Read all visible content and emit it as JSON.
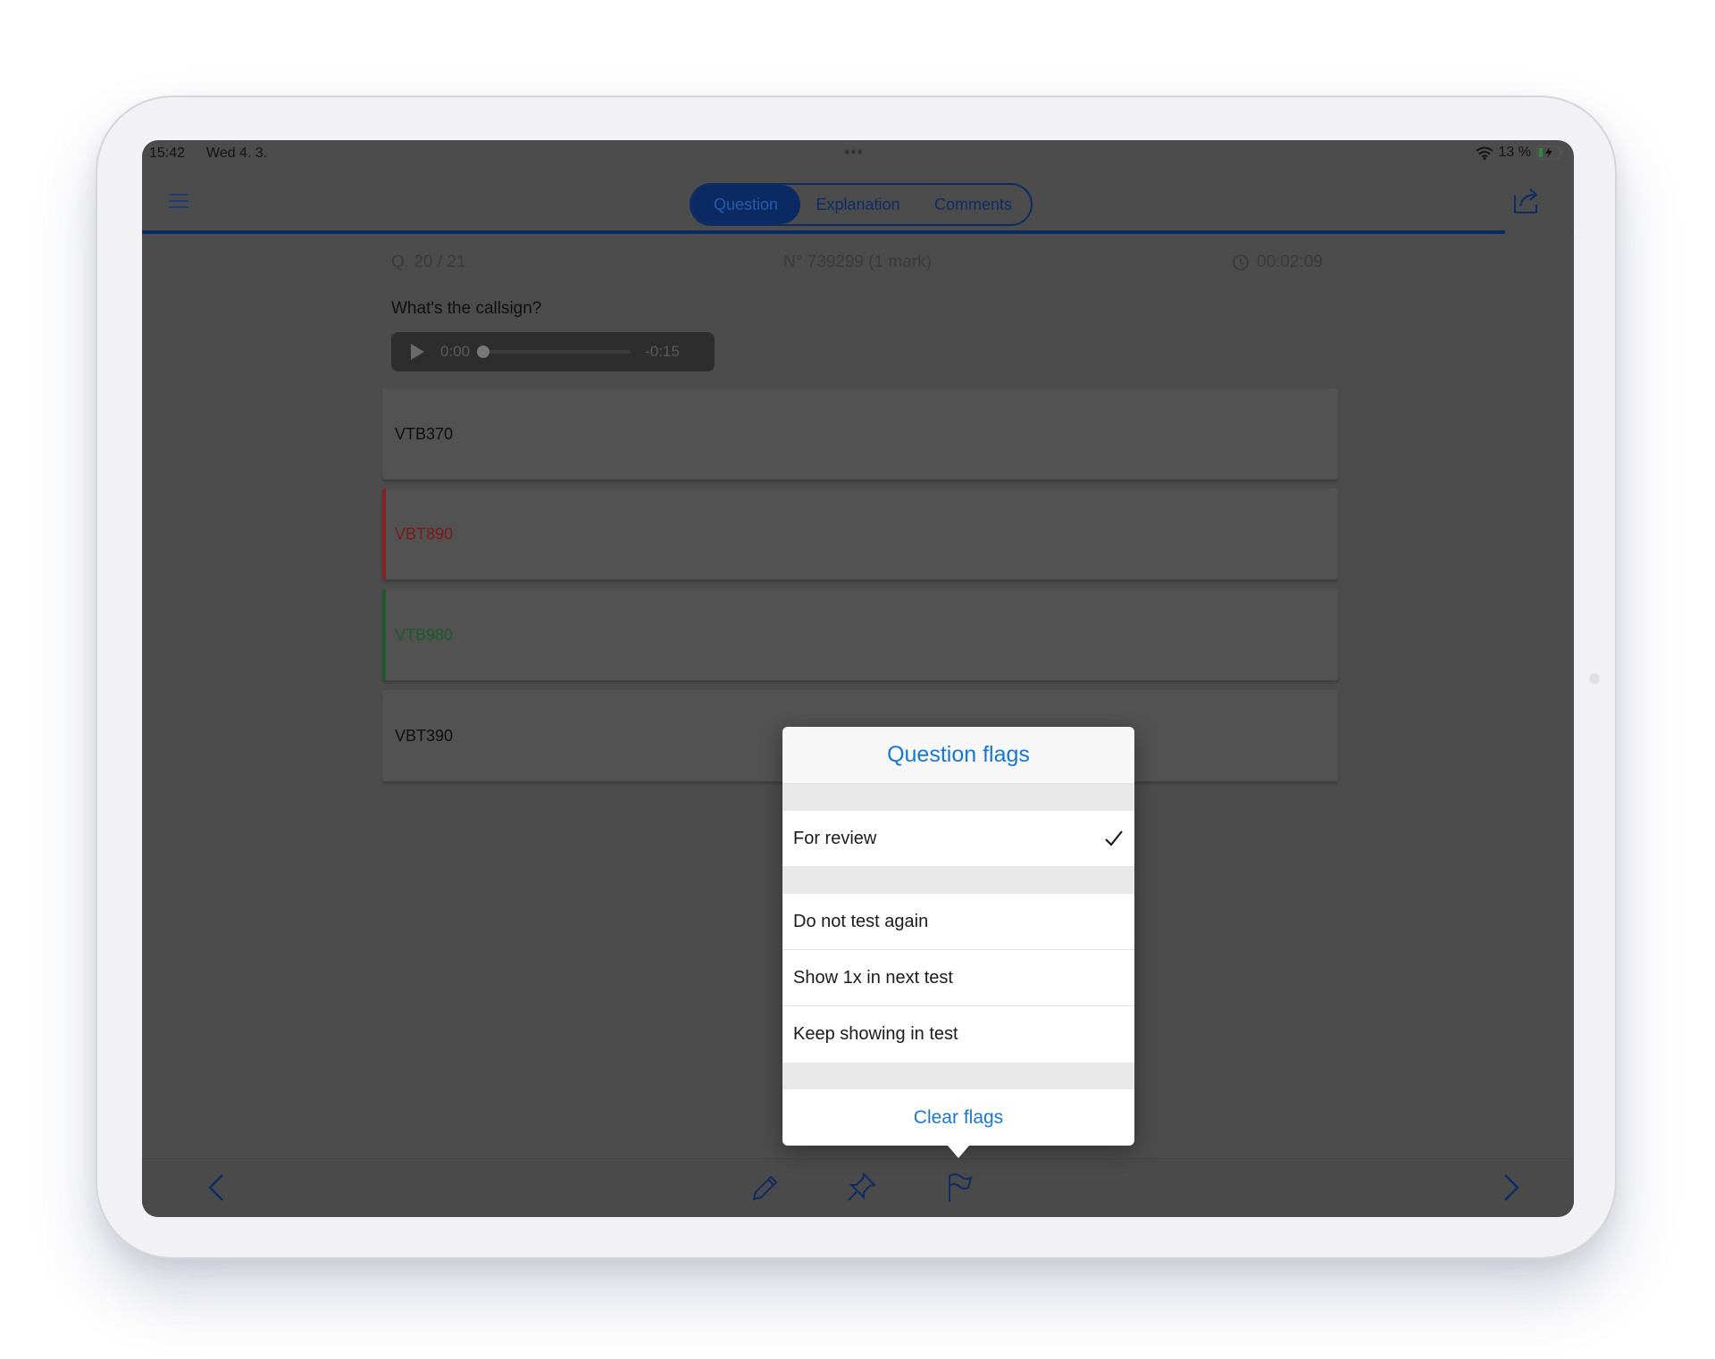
{
  "status_bar": {
    "time": "15:42",
    "date": "Wed 4. 3.",
    "battery": "13 %"
  },
  "tabs": [
    {
      "label": "Question",
      "active": true
    },
    {
      "label": "Explanation",
      "active": false
    },
    {
      "label": "Comments",
      "active": false
    }
  ],
  "progress": {
    "fraction": 0.952
  },
  "question": {
    "counter": "Q. 20 / 21",
    "number": "N° 739299 (1 mark)",
    "timer": "00:02:09",
    "text": "What's the callsign?"
  },
  "audio": {
    "current": "0:00",
    "duration": "-0:15"
  },
  "answers": [
    {
      "text": "VTB370",
      "state": "normal"
    },
    {
      "text": "VBT890",
      "state": "wrong"
    },
    {
      "text": "VTB980",
      "state": "correct"
    },
    {
      "text": "VBT390",
      "state": "normal"
    }
  ],
  "popover": {
    "title": "Question flags",
    "review_label": "For review",
    "review_checked": true,
    "options": [
      "Do not test again",
      "Show 1x in next test",
      "Keep showing in test"
    ],
    "clear_label": "Clear flags"
  },
  "colors": {
    "accent": "#1878d1",
    "tab_border": "#0d2c66",
    "wrong": "#8b1f1f",
    "correct": "#1b5a2a"
  },
  "icons": {
    "menu": "hamburger-icon",
    "share": "share-icon",
    "timer": "clock-icon",
    "prev": "chevron-left-icon",
    "next": "chevron-right-icon",
    "note": "pencil-icon",
    "pin": "pushpin-icon",
    "flag": "flag-icon"
  }
}
